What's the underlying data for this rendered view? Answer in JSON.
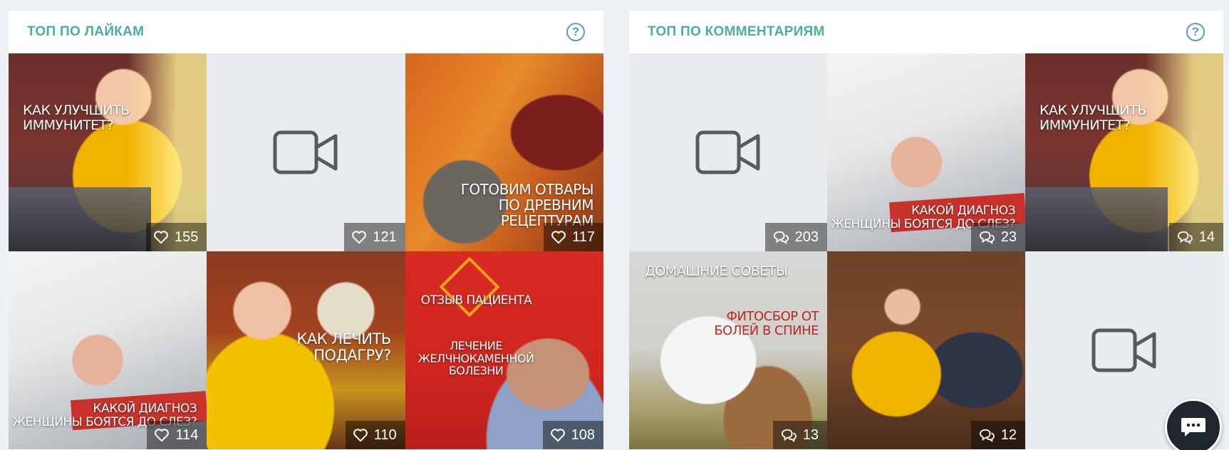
{
  "panels": {
    "likes": {
      "title": "ТОП ПО ЛАЙКАМ",
      "help": "?",
      "tiles": [
        {
          "kind": "photo",
          "caption": "КАК УЛУЧШИТЬ\nИММУНИТЕТ?",
          "count": "155"
        },
        {
          "kind": "video",
          "caption": "",
          "count": "121"
        },
        {
          "kind": "photo",
          "caption": "ГОТОВИМ ОТВАРЫ\nПО ДРЕВНИМ\nРЕЦЕПТУРАМ",
          "count": "117"
        },
        {
          "kind": "photo",
          "caption": "КАКОЙ ДИАГНОЗ\nЖЕНЩИНЫ БОЯТСЯ ДО СЛЕЗ?",
          "count": "114"
        },
        {
          "kind": "photo",
          "caption": "КАК ЛЕЧИТЬ\nПОДАГРУ?",
          "count": "110"
        },
        {
          "kind": "photo",
          "caption": "ОТЗЫВ ПАЦИЕНТА",
          "caption2": "ЛЕЧЕНИЕ\nЖЕЛЧНОКАМЕННОЙ\nБОЛЕЗНИ",
          "count": "108"
        }
      ]
    },
    "comments": {
      "title": "ТОП ПО КОММЕНТАРИЯМ",
      "help": "?",
      "tiles": [
        {
          "kind": "video",
          "caption": "",
          "count": "203"
        },
        {
          "kind": "photo",
          "caption": "КАКОЙ ДИАГНОЗ\nЖЕНЩИНЫ БОЯТСЯ ДО СЛЕЗ?",
          "count": "23"
        },
        {
          "kind": "photo",
          "caption": "КАК УЛУЧШИТЬ\nИММУНИТЕТ?",
          "count": "14"
        },
        {
          "kind": "photo",
          "caption": "ДОМАШНИЕ СОВЕТЫ",
          "caption2": "ФИТОСБОР ОТ\nБОЛЕЙ В СПИНЕ",
          "count": "13"
        },
        {
          "kind": "photo",
          "caption": "",
          "count": "12"
        },
        {
          "kind": "video",
          "caption": "",
          "count": ""
        }
      ]
    }
  },
  "icons": {
    "likes_stat": "heart-icon",
    "comments_stat": "comments-icon",
    "placeholder": "video-camera-icon",
    "chat": "chat-bubble-icon",
    "help": "question-circle-icon"
  },
  "colors": {
    "accent_title": "#4caf9a",
    "help": "#5a9bc8",
    "background": "#edf0f4",
    "chat_button": "#20262d"
  }
}
